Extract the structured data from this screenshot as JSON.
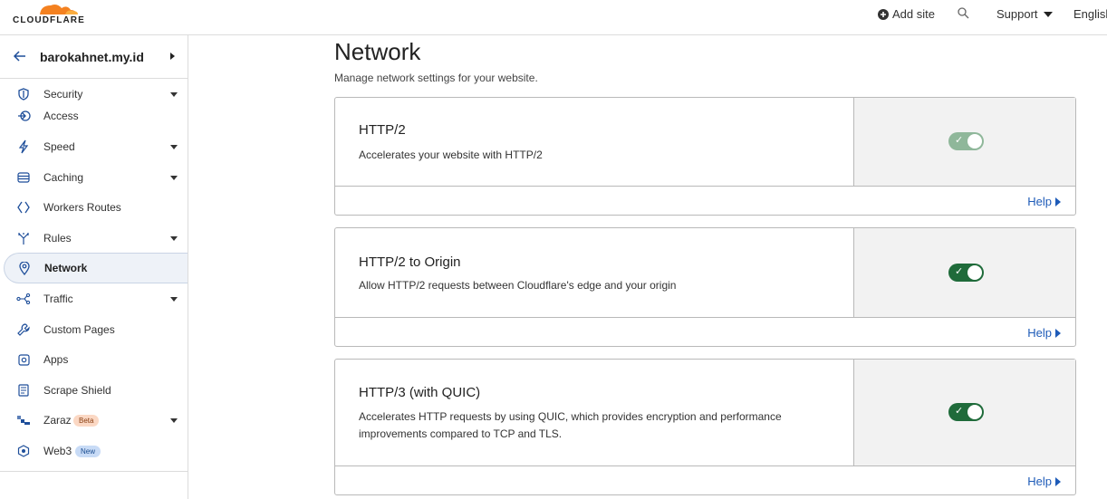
{
  "brand": {
    "name": "CLOUDFLARE",
    "color": "#f48120"
  },
  "topbar": {
    "add_site": "Add site",
    "support": "Support",
    "language": "English"
  },
  "sidebar": {
    "site_name": "barokahnet.my.id",
    "items": [
      {
        "label": "Security",
        "icon": "shield-icon",
        "has_caret": true
      },
      {
        "label": "Access",
        "icon": "access-icon",
        "has_caret": false
      },
      {
        "label": "Speed",
        "icon": "lightning-icon",
        "has_caret": true
      },
      {
        "label": "Caching",
        "icon": "caching-icon",
        "has_caret": true
      },
      {
        "label": "Workers Routes",
        "icon": "workers-icon",
        "has_caret": false
      },
      {
        "label": "Rules",
        "icon": "rules-icon",
        "has_caret": true
      },
      {
        "label": "Network",
        "icon": "location-pin-icon",
        "has_caret": false,
        "active": true
      },
      {
        "label": "Traffic",
        "icon": "traffic-icon",
        "has_caret": true
      },
      {
        "label": "Custom Pages",
        "icon": "wrench-icon",
        "has_caret": false
      },
      {
        "label": "Apps",
        "icon": "apps-icon",
        "has_caret": false
      },
      {
        "label": "Scrape Shield",
        "icon": "document-icon",
        "has_caret": false
      },
      {
        "label": "Zaraz",
        "icon": "zaraz-icon",
        "has_caret": true,
        "badge": "Beta"
      },
      {
        "label": "Web3",
        "icon": "web3-icon",
        "has_caret": false,
        "badge": "New"
      }
    ]
  },
  "main": {
    "title": "Network",
    "subtitle": "Manage network settings for your website.",
    "help_label": "Help",
    "cards": [
      {
        "title": "HTTP/2",
        "description": "Accelerates your website with HTTP/2",
        "enabled": true,
        "disabled_control": true
      },
      {
        "title": "HTTP/2 to Origin",
        "description": "Allow HTTP/2 requests between Cloudflare's edge and your origin",
        "enabled": true,
        "disabled_control": false
      },
      {
        "title": "HTTP/3 (with QUIC)",
        "description": "Accelerates HTTP requests by using QUIC, which provides encryption and performance improvements compared to TCP and TLS.",
        "enabled": true,
        "disabled_control": false
      }
    ]
  },
  "colors": {
    "toggle_on": "#1f6b3a",
    "link": "#1e5bb8",
    "active_nav_bg": "#eef2f8"
  }
}
